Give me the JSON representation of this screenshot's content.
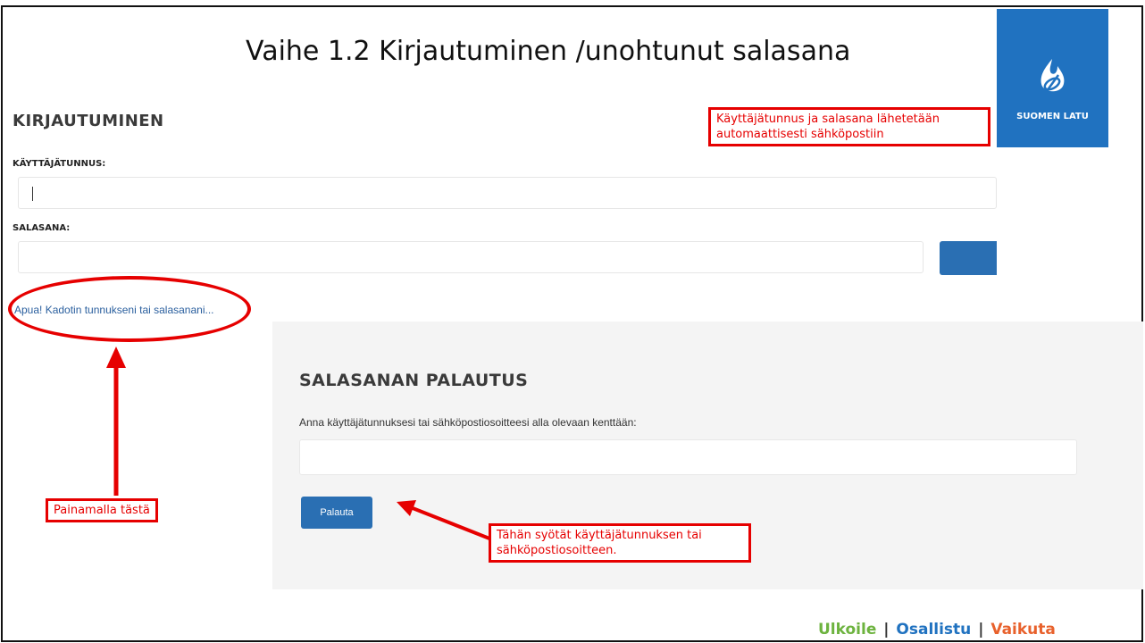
{
  "slide": {
    "title": "Vaihe 1.2 Kirjautuminen /unohtunut salasana"
  },
  "logo": {
    "text": "SUOMEN LATU",
    "color": "#2072c0"
  },
  "login": {
    "title": "KIRJAUTUMINEN",
    "username_label": "KÄYTTÄJÄTUNNUS:",
    "username_value": "",
    "password_label": "SALASANA:",
    "password_value": "",
    "forgot_link": "Apua! Kadotin tunnukseni tai salasanani..."
  },
  "reset": {
    "title": "SALASANAN PALAUTUS",
    "description": "Anna käyttäjätunnuksesi tai sähköpostiosoitteesi alla olevaan kenttään:",
    "input_value": "",
    "button_label": "Palauta"
  },
  "callouts": {
    "email_note": "Käyttäjätunnus ja salasana lähetetään automaattisesti sähköpostiin",
    "click_here": "Painamalla tästä",
    "input_note": "Tähän syötät käyttäjätunnuksen tai sähköpostiosoitteen."
  },
  "slogan": {
    "part1": "Ulkoile",
    "sep1": "|",
    "part2": "Osallistu",
    "sep2": "|",
    "part3": "Vaikuta",
    "colors": {
      "part1": "#6db33f",
      "part2": "#2072c0",
      "part3": "#e8612c",
      "sep": "#333333"
    }
  },
  "colors": {
    "accent_red": "#e60000",
    "button_blue": "#2a6fb3"
  }
}
